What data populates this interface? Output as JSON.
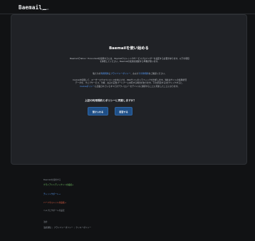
{
  "header": {
    "logo": "Baemail",
    "logo_sub": "by Dash"
  },
  "card": {
    "title": "Baemailを使い始める",
    "para1_line1": "BaemailでYahoo・Economistを使用するには、Paymailウォレットやサービスプロバイダーを設定する必要があります。以下の項目",
    "para1_line2": "を参照してください。Baemailの使用を開始する準備が整います。",
    "para2_pre": "私たちの",
    "para2_link1": "利用規約",
    "para2_mid": "と",
    "para2_link2": "プライバシーポリシー",
    "para2_mid2": "、および",
    "para2_link3": "その他規約",
    "para2_post": "をご確認ください。",
    "para3_line1": "Cookieを使用して、ユーザーエクスペリエンスを向上させ、Webサイトのトラフィックを分析します。当社はサイトの使用状況",
    "para3_line2": "データを、ウェブサービス、分析、および広告パートナーと共有する場合があります。下の[同意する]をクリックすると、",
    "para3_link": "Cookieポリシー",
    "para3_line3": "に記載されているすべてのテクノロジーをデバイスに保存することに同意したことになります。",
    "question": "上記の利用規約とポリシーに同意しますか？",
    "accept_label": "受け入れる",
    "reject_label": "拒否する"
  },
  "footer": {
    "head": "Baemailを使用する",
    "green": "クライアントディレクトリの接続",
    "green_arrow": "→",
    "blue": "チャットサポート",
    "blue_arrow": "→",
    "red": "ハードウォレットの接続",
    "red_arrow": "→",
    "gray": "ヘルプとサポートの設定",
    "small": "法的",
    "link1": "法的通知",
    "link2": "プライバシーポリシー",
    "link3": "クッキーポリシー",
    "sep": "|"
  }
}
